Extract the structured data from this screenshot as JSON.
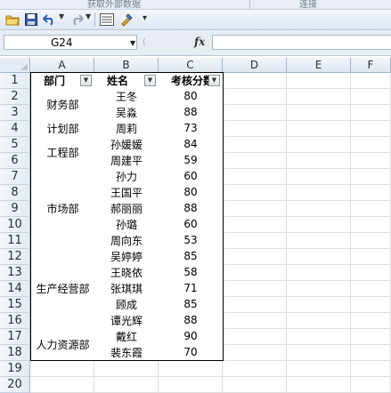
{
  "ribbon": {
    "group1_label": "获取外部数据",
    "group2_label": "连接"
  },
  "toolbar": {
    "icons": [
      "open-folder-icon",
      "save-icon",
      "undo-icon",
      "redo-icon",
      "form-icon",
      "format-painter-icon",
      "customize-toolbar-icon"
    ]
  },
  "formula_bar": {
    "name_box": "G24",
    "fx_label": "fx",
    "formula": ""
  },
  "columns": [
    "A",
    "B",
    "C",
    "D",
    "E",
    "F"
  ],
  "rows": [
    "1",
    "2",
    "3",
    "4",
    "5",
    "6",
    "7",
    "8",
    "9",
    "10",
    "11",
    "12",
    "13",
    "14",
    "15",
    "16",
    "17",
    "18",
    "19",
    "20"
  ],
  "table": {
    "headers": [
      "部门",
      "姓名",
      "考核分数"
    ],
    "departments": [
      {
        "name": "财务部",
        "rows": [
          2,
          3
        ]
      },
      {
        "name": "计划部",
        "rows": [
          4
        ]
      },
      {
        "name": "工程部",
        "rows": [
          5,
          6
        ]
      },
      {
        "name": "市场部",
        "rows": [
          7,
          11
        ]
      },
      {
        "name": "生产经营部",
        "rows": [
          12,
          16
        ]
      },
      {
        "name": "人力资源部",
        "rows": [
          17,
          18
        ]
      }
    ],
    "names": [
      "王冬",
      "吴淼",
      "周莉",
      "孙媛媛",
      "周建平",
      "孙力",
      "王国平",
      "郝丽丽",
      "孙璐",
      "周向东",
      "吴婷婷",
      "王晓依",
      "张琪琪",
      "顾成",
      "谭光辉",
      "戴红",
      "裴东霞"
    ],
    "scores": [
      "80",
      "88",
      "73",
      "84",
      "59",
      "60",
      "80",
      "88",
      "60",
      "53",
      "85",
      "58",
      "71",
      "85",
      "88",
      "90",
      "70"
    ]
  }
}
